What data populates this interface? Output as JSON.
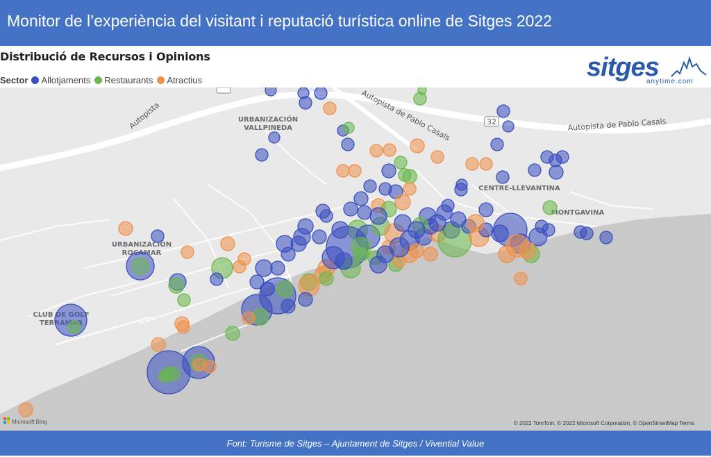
{
  "header": {
    "title": "Monitor de l’experiència del visitant i reputació turística online de Sitges 2022"
  },
  "visual": {
    "title": "Distribució de Recursos i Opinions",
    "legend_title": "Sector",
    "legend": [
      {
        "label": "Allotjaments",
        "color": "#3a4fbf"
      },
      {
        "label": "Restaurants",
        "color": "#6ab84a"
      },
      {
        "label": "Atractius",
        "color": "#f0914a"
      }
    ]
  },
  "logo": {
    "word": "sitges",
    "sub": "anytime.com"
  },
  "map": {
    "places": [
      "URBANIZACIÓN",
      "VALLPINEDA",
      "URBANIZACIÓN",
      "ROCAMAR",
      "CLUB DE GOLF",
      "TERRAMAR",
      "CENTRE-LLEVANTINA",
      "MONTGAVINA"
    ],
    "road_labels": [
      "Autopista de Pablo Casals",
      "Autopista de Pablo Casals",
      "Autopista",
      "32",
      "32"
    ],
    "attribution": "© 2022 TomTom, © 2022 Microsoft Corporation, © OpenStreetMap  Terms",
    "bing": "Microsoft Bing"
  },
  "footer": {
    "text": "Font: Turisme de Sitges – Ajuntament de Sitges / Vivential Value"
  }
}
